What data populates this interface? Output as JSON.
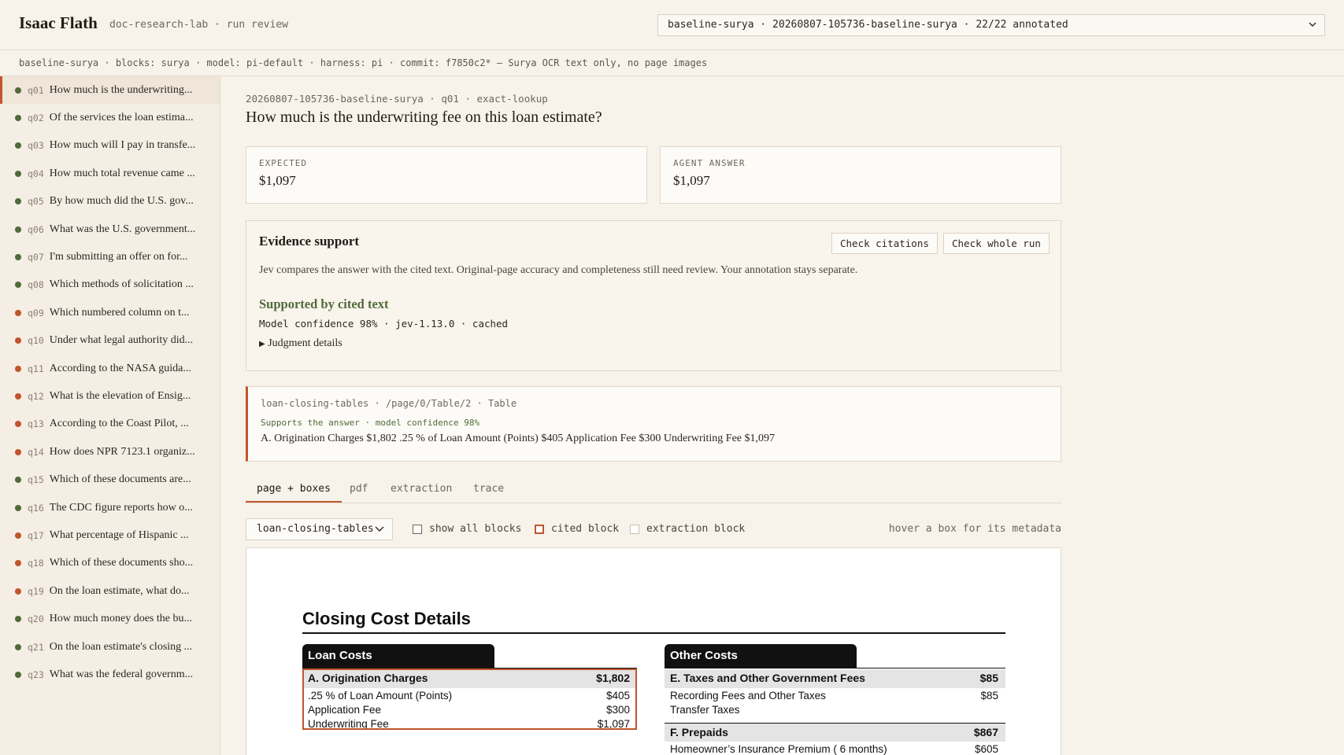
{
  "header": {
    "brand": "Isaac Flath",
    "crumb": "doc-research-lab · run review",
    "run_select": "baseline-surya · 20260807-105736-baseline-surya · 22/22 annotated"
  },
  "run_meta": "baseline-surya · blocks: surya · model: pi-default · harness: pi · commit: f7850c2* — Surya OCR text only, no page images",
  "sidebar": {
    "items": [
      {
        "id": "q01",
        "text": "How much is the underwriting...",
        "status": "good"
      },
      {
        "id": "q02",
        "text": "Of the services the loan estima...",
        "status": "good"
      },
      {
        "id": "q03",
        "text": "How much will I pay in transfe...",
        "status": "good"
      },
      {
        "id": "q04",
        "text": "How much total revenue came ...",
        "status": "good"
      },
      {
        "id": "q05",
        "text": "By how much did the U.S. gov...",
        "status": "good"
      },
      {
        "id": "q06",
        "text": "What was the U.S. government...",
        "status": "good"
      },
      {
        "id": "q07",
        "text": "I'm submitting an offer on for...",
        "status": "good"
      },
      {
        "id": "q08",
        "text": "Which methods of solicitation ...",
        "status": "good"
      },
      {
        "id": "q09",
        "text": "Which numbered column on t...",
        "status": "bad"
      },
      {
        "id": "q10",
        "text": "Under what legal authority did...",
        "status": "bad"
      },
      {
        "id": "q11",
        "text": "According to the NASA guida...",
        "status": "bad"
      },
      {
        "id": "q12",
        "text": "What is the elevation of Ensig...",
        "status": "bad"
      },
      {
        "id": "q13",
        "text": "According to the Coast Pilot, ...",
        "status": "bad"
      },
      {
        "id": "q14",
        "text": "How does NPR 7123.1 organiz...",
        "status": "bad"
      },
      {
        "id": "q15",
        "text": "Which of these documents are...",
        "status": "good"
      },
      {
        "id": "q16",
        "text": "The CDC figure reports how o...",
        "status": "good"
      },
      {
        "id": "q17",
        "text": "What percentage of Hispanic ...",
        "status": "bad"
      },
      {
        "id": "q18",
        "text": "Which of these documents sho...",
        "status": "bad"
      },
      {
        "id": "q19",
        "text": "On the loan estimate, what do...",
        "status": "bad"
      },
      {
        "id": "q20",
        "text": "How much money does the bu...",
        "status": "good"
      },
      {
        "id": "q21",
        "text": "On the loan estimate's closing ...",
        "status": "good"
      },
      {
        "id": "q23",
        "text": "What was the federal governm...",
        "status": "good"
      }
    ]
  },
  "question": {
    "meta": "20260807-105736-baseline-surya · q01 · exact-lookup",
    "title": "How much is the underwriting fee on this loan estimate?"
  },
  "answers": {
    "expected_label": "EXPECTED",
    "expected_value": "$1,097",
    "agent_label": "AGENT ANSWER",
    "agent_value": "$1,097"
  },
  "evidence": {
    "title": "Evidence support",
    "check_citations": "Check citations",
    "check_run": "Check whole run",
    "description": "Jev compares the answer with the cited text. Original-page accuracy and completeness still need review. Your annotation stays separate.",
    "verdict": "Supported by cited text",
    "confidence": "Model confidence 98% · jev-1.13.0 · cached",
    "details": "Judgment details"
  },
  "citation": {
    "path": "loan-closing-tables · /page/0/Table/2 · Table",
    "support": "Supports the answer · model confidence 98%",
    "text": "A. Origination Charges $1,802 .25 % of Loan Amount (Points) $405 Application Fee $300 Underwriting Fee $1,097"
  },
  "tabs": [
    "page + boxes",
    "pdf",
    "extraction",
    "trace"
  ],
  "controls": {
    "doc_select": "loan-closing-tables",
    "show_all": "show all blocks",
    "cited": "cited block",
    "extraction": "extraction block",
    "hint": "hover a box for its metadata"
  },
  "document": {
    "heading": "Closing Cost Details",
    "loan_costs": {
      "tab": "Loan Costs",
      "section": "A.  Origination Charges",
      "section_amt": "$1,802",
      "rows": [
        {
          "label": ".25 % of Loan Amount (Points)",
          "amt": "$405"
        },
        {
          "label": "Application Fee",
          "amt": "$300"
        },
        {
          "label": "Underwriting Fee",
          "amt": "$1,097"
        }
      ]
    },
    "other_costs": {
      "tab": "Other Costs",
      "section_e": "E.  Taxes and Other Government Fees",
      "section_e_amt": "$85",
      "rows_e": [
        {
          "label": "Recording Fees and Other Taxes",
          "amt": "$85"
        },
        {
          "label": "Transfer Taxes",
          "amt": ""
        }
      ],
      "section_f": "F.  Prepaids",
      "section_f_amt": "$867",
      "rows_f": [
        {
          "label": "Homeowner’s Insurance Premium (  6   months)",
          "amt": "$605"
        }
      ]
    }
  },
  "colors": {
    "accent": "#c0552d",
    "good": "#4f6b3a",
    "bad": "#c0552d"
  }
}
